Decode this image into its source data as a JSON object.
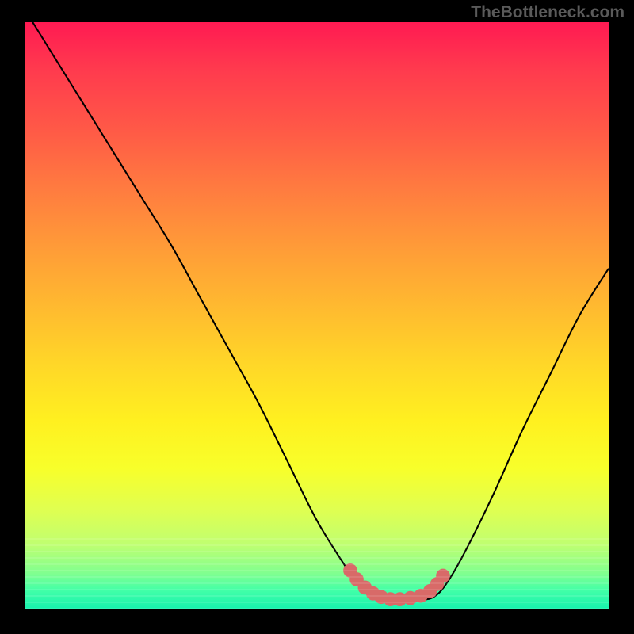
{
  "watermark": "TheBottleneck.com",
  "chart_data": {
    "type": "line",
    "title": "",
    "xlabel": "",
    "ylabel": "",
    "xlim": [
      0,
      100
    ],
    "ylim": [
      0,
      100
    ],
    "curve": {
      "name": "bottleneck-curve",
      "x": [
        0,
        5,
        10,
        15,
        20,
        25,
        30,
        35,
        40,
        45,
        50,
        55,
        57,
        60,
        62,
        65,
        68,
        70,
        72,
        75,
        80,
        85,
        90,
        95,
        100
      ],
      "values": [
        102,
        94,
        86,
        78,
        70,
        62,
        53,
        44,
        35,
        25,
        15,
        7,
        4,
        2,
        1.5,
        1.3,
        1.5,
        2,
        4,
        9,
        19,
        30,
        40,
        50,
        58
      ]
    },
    "markers_x": [
      55.7,
      56.8,
      58.2,
      59.6,
      61.0,
      62.6,
      64.2,
      66.0,
      67.8,
      69.4,
      70.6,
      71.6
    ],
    "markers_y": [
      6.5,
      5.0,
      3.6,
      2.6,
      2.0,
      1.6,
      1.6,
      1.8,
      2.2,
      3.0,
      4.2,
      5.6
    ],
    "marker_radius": 1.2,
    "gradient_stops": [
      {
        "pos": 0.0,
        "color": "#ff1a52"
      },
      {
        "pos": 0.5,
        "color": "#ffd628"
      },
      {
        "pos": 0.8,
        "color": "#e0ff50"
      },
      {
        "pos": 1.0,
        "color": "#18f2ae"
      }
    ]
  }
}
